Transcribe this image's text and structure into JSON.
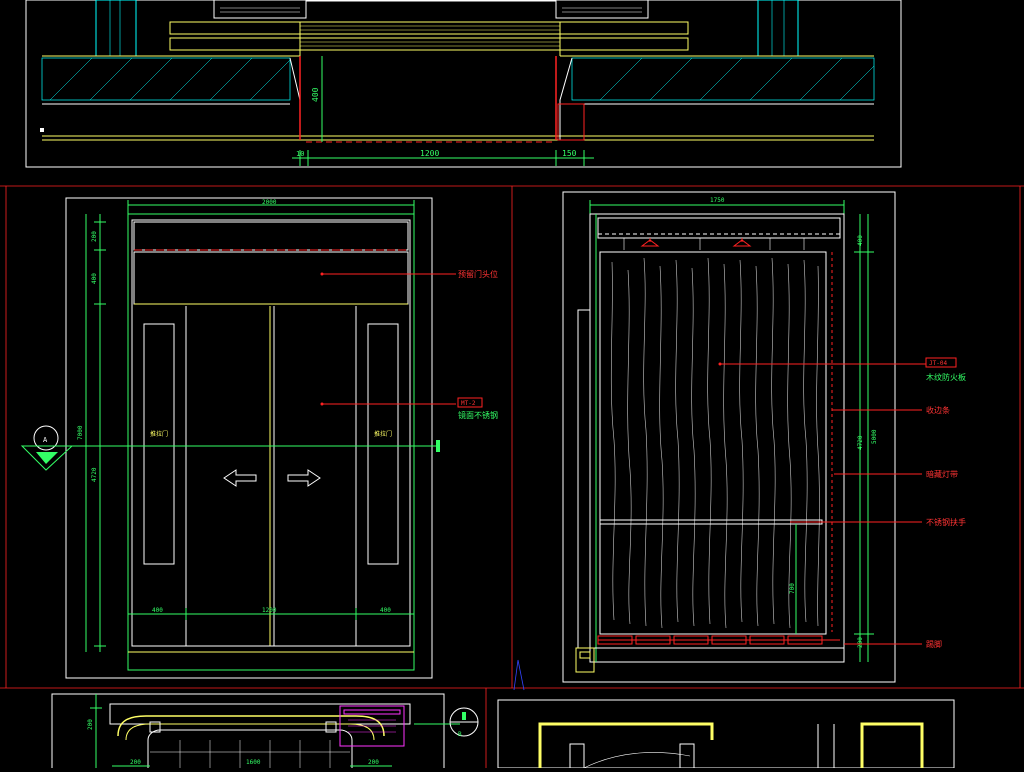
{
  "plan": {
    "dim_opening": "1200",
    "dim_right": "150",
    "dim_left": "10",
    "dim_depth": "400"
  },
  "front_elevation": {
    "top_dim": "2000",
    "vert_dims": [
      "200",
      "400",
      "4720",
      "7000"
    ],
    "bottom_dims": [
      "400",
      "1200",
      "400"
    ],
    "note_1": "预留门头位",
    "tag": "MT-2",
    "note_2": "镜面不锈钢",
    "handle_text": "推拉门",
    "section_mark": "A"
  },
  "side_section": {
    "top_dim": "1750",
    "vert_dims": [
      "400",
      "4720",
      "5000",
      "700",
      "200"
    ],
    "tag": "JT-04",
    "note_1": "木纹防火板",
    "note_2": "收边条",
    "note_3": "暗藏灯带",
    "note_4": "不锈钢扶手",
    "note_5": "踢脚"
  },
  "detail_plan": {
    "dims": [
      "200",
      "200",
      "1600",
      "200"
    ],
    "section_mark": "B"
  },
  "colors": {
    "outline": "#ffffff",
    "frame": "#ffff66",
    "dim": "#33ff66",
    "aux": "#00ffff",
    "leader": "#ff2222",
    "detail": "#ff33ff"
  }
}
